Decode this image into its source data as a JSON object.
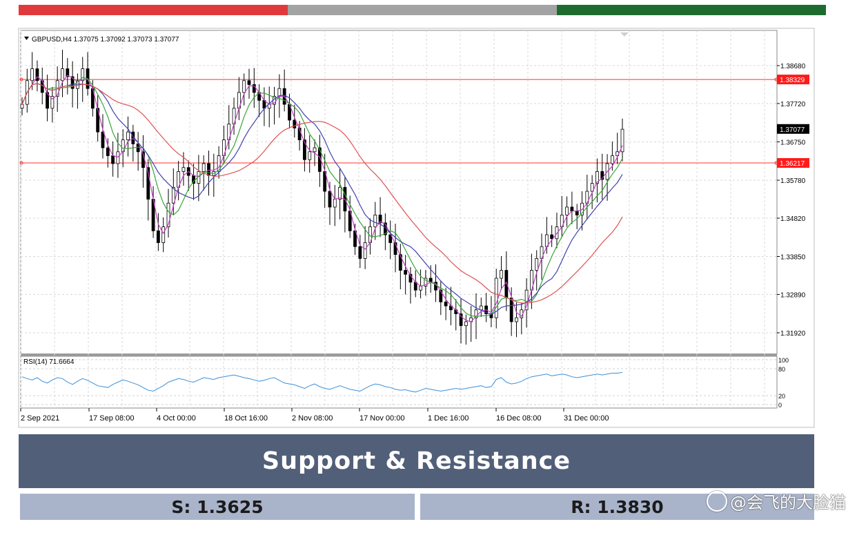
{
  "header_bars": {
    "colors": [
      "#e0393b",
      "#a3a3a3",
      "#1e6b30"
    ]
  },
  "chart_title": "GBPUSD,H4  1.37075 1.37092 1.37073 1.37077",
  "rsi_title": "RSI(14) 71.6664",
  "chart_data": {
    "type": "candlestick",
    "symbol": "GBPUSD",
    "timeframe": "H4",
    "ohlc_last": [
      1.37075,
      1.37092,
      1.37073,
      1.37077
    ],
    "y_ticks": [
      "1.38680",
      "1.37720",
      "1.36750",
      "1.35780",
      "1.34820",
      "1.33850",
      "1.32890",
      "1.31920"
    ],
    "ylim": [
      1.3125,
      1.3962
    ],
    "x_ticks": [
      "2 Sep 2021",
      "17 Sep 08:00",
      "4 Oct 00:00",
      "18 Oct 16:00",
      "2 Nov 08:00",
      "17 Nov 00:00",
      "1 Dec 16:00",
      "16 Dec 08:00",
      "31 Dec 00:00"
    ],
    "price_labels": [
      {
        "value": 1.38329,
        "text": "1.38329",
        "color": "#ff1a1a"
      },
      {
        "value": 1.37077,
        "text": "1.37077",
        "color": "#000000"
      },
      {
        "value": 1.36217,
        "text": "1.36217",
        "color": "#ff1a1a"
      }
    ],
    "horizontal_lines": [
      1.38329,
      1.36217
    ],
    "moving_averages_colors": [
      "#c040c0",
      "#3aa53a",
      "#4040b0",
      "#e05050"
    ],
    "rsi": {
      "period": 14,
      "value": 71.6664,
      "levels": [
        100,
        80,
        20,
        0
      ],
      "level_labels": [
        "100",
        "80",
        "20",
        "0"
      ]
    },
    "close_series": [
      1.377,
      1.383,
      1.386,
      1.383,
      1.38,
      1.376,
      1.379,
      1.383,
      1.386,
      1.384,
      1.381,
      1.383,
      1.386,
      1.381,
      1.376,
      1.37,
      1.366,
      1.364,
      1.362,
      1.365,
      1.368,
      1.37,
      1.367,
      1.365,
      1.361,
      1.353,
      1.345,
      1.342,
      1.346,
      1.352,
      1.356,
      1.36,
      1.361,
      1.359,
      1.357,
      1.36,
      1.362,
      1.359,
      1.36,
      1.364,
      1.368,
      1.372,
      1.376,
      1.38,
      1.383,
      1.382,
      1.38,
      1.378,
      1.376,
      1.377,
      1.379,
      1.381,
      1.377,
      1.373,
      1.371,
      1.368,
      1.363,
      1.365,
      1.366,
      1.36,
      1.355,
      1.351,
      1.353,
      1.356,
      1.35,
      1.345,
      1.341,
      1.338,
      1.342,
      1.346,
      1.349,
      1.347,
      1.344,
      1.342,
      1.339,
      1.335,
      1.334,
      1.332,
      1.33,
      1.331,
      1.333,
      1.332,
      1.33,
      1.327,
      1.326,
      1.325,
      1.324,
      1.321,
      1.322,
      1.323,
      1.325,
      1.326,
      1.324,
      1.323,
      1.333,
      1.335,
      1.328,
      1.322,
      1.323,
      1.325,
      1.33,
      1.335,
      1.338,
      1.341,
      1.344,
      1.343,
      1.346,
      1.349,
      1.351,
      1.35,
      1.349,
      1.352,
      1.355,
      1.357,
      1.36,
      1.358,
      1.362,
      1.364,
      1.365,
      1.3707
    ],
    "rsi_series": [
      62,
      58,
      55,
      60,
      52,
      48,
      55,
      60,
      58,
      50,
      45,
      52,
      58,
      54,
      48,
      42,
      40,
      38,
      45,
      50,
      55,
      52,
      48,
      44,
      38,
      32,
      30,
      36,
      42,
      50,
      54,
      58,
      56,
      52,
      50,
      55,
      60,
      58,
      56,
      60,
      62,
      64,
      66,
      63,
      60,
      58,
      55,
      52,
      54,
      58,
      60,
      54,
      48,
      46,
      44,
      40,
      36,
      42,
      46,
      40,
      36,
      34,
      38,
      42,
      38,
      34,
      32,
      30,
      36,
      42,
      46,
      44,
      40,
      38,
      34,
      32,
      33,
      30,
      28,
      32,
      36,
      34,
      32,
      30,
      32,
      34,
      36,
      34,
      36,
      38,
      40,
      42,
      38,
      40,
      56,
      60,
      50,
      46,
      48,
      52,
      58,
      62,
      64,
      66,
      68,
      64,
      66,
      68,
      66,
      62,
      60,
      62,
      64,
      66,
      68,
      66,
      68,
      70,
      70,
      71.67
    ]
  },
  "banner": {
    "title": "Support & Resistance"
  },
  "levels": {
    "support": "S: 1.3625",
    "resistance": "R: 1.3830"
  },
  "watermark": {
    "text": "@会飞的大脸猫"
  }
}
